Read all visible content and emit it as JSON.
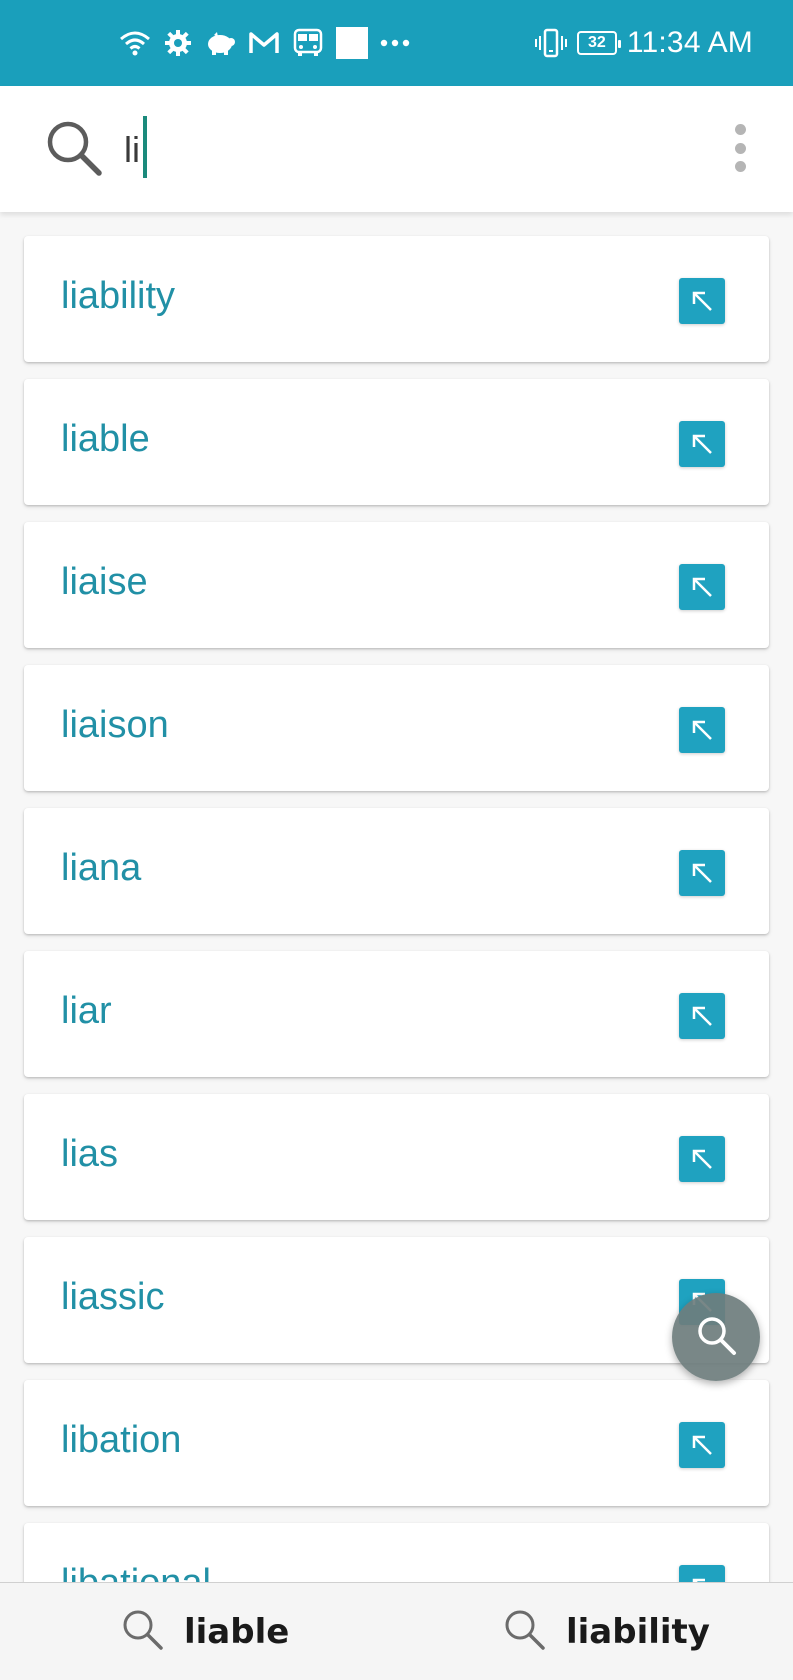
{
  "status_bar": {
    "time": "11:34 AM",
    "battery_level": "32",
    "left_icons": [
      "wifi-icon",
      "settings-icon",
      "piggy-bank-icon",
      "gmail-icon",
      "bus-icon",
      "white-square-icon",
      "more-dots-icon"
    ],
    "right_icons": [
      "vibrate-icon",
      "battery-icon"
    ],
    "background_color": "#1a9fbb"
  },
  "search": {
    "value": "li",
    "placeholder": ""
  },
  "results": [
    {
      "label": "liability"
    },
    {
      "label": "liable"
    },
    {
      "label": "liaise"
    },
    {
      "label": "liaison"
    },
    {
      "label": "liana"
    },
    {
      "label": "liar"
    },
    {
      "label": "lias"
    },
    {
      "label": "liassic"
    },
    {
      "label": "libation"
    },
    {
      "label": "libational"
    }
  ],
  "recent_searches": [
    "liable",
    "liability"
  ],
  "colors": {
    "accent": "#1fa2c0",
    "result_text": "#2190a6",
    "caret": "#1b8a7c"
  }
}
